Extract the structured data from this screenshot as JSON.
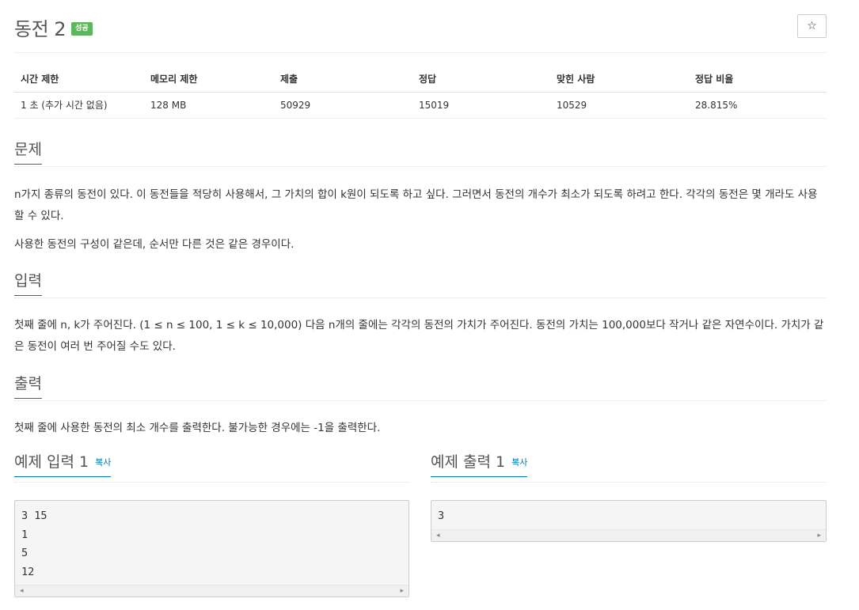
{
  "header": {
    "title": "동전 2",
    "result_badge": "성공",
    "star_icon": "☆"
  },
  "info_table": {
    "columns": [
      "시간 제한",
      "메모리 제한",
      "제출",
      "정답",
      "맞힌 사람",
      "정답 비율"
    ],
    "row": [
      "1 초 (추가 시간 없음)",
      "128 MB",
      "50929",
      "15019",
      "10529",
      "28.815%"
    ]
  },
  "problem": {
    "heading": "문제",
    "paragraphs": [
      "n가지 종류의 동전이 있다. 이 동전들을 적당히 사용해서, 그 가치의 합이 k원이 되도록 하고 싶다. 그러면서 동전의 개수가 최소가 되도록 하려고 한다. 각각의 동전은 몇 개라도 사용할 수 있다.",
      "사용한 동전의 구성이 같은데, 순서만 다른 것은 같은 경우이다."
    ]
  },
  "input": {
    "heading": "입력",
    "text": "첫째 줄에 n, k가 주어진다. (1 ≤ n ≤ 100, 1 ≤ k ≤ 10,000) 다음 n개의 줄에는 각각의 동전의 가치가 주어진다. 동전의 가치는 100,000보다 작거나 같은 자연수이다. 가치가 같은 동전이 여러 번 주어질 수도 있다."
  },
  "output": {
    "heading": "출력",
    "text": "첫째 줄에 사용한 동전의 최소 개수를 출력한다. 불가능한 경우에는 -1을 출력한다."
  },
  "sample_input": {
    "heading": "예제 입력 1",
    "copy_label": "복사",
    "lines": [
      "3 15",
      "1",
      "5",
      "12"
    ]
  },
  "sample_output": {
    "heading": "예제 출력 1",
    "copy_label": "복사",
    "lines": [
      "3"
    ]
  },
  "scroll_arrows": {
    "left": "◂",
    "right": "▸"
  },
  "colors": {
    "accent": "#0076c0",
    "success": "#5cb85c",
    "text": "#333333",
    "heading": "#555555"
  }
}
